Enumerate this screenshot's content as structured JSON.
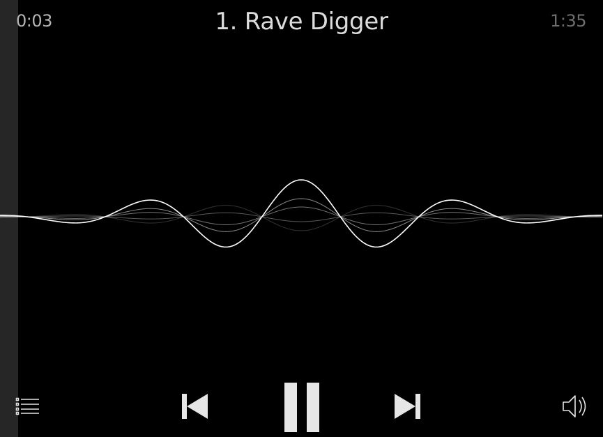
{
  "player": {
    "elapsed": "0:03",
    "title": "1. Rave Digger",
    "duration": "1:35"
  },
  "controls": {
    "playlist": "list-icon",
    "previous": "skip-previous-icon",
    "pause": "pause-icon",
    "next": "skip-next-icon",
    "volume": "speaker-icon"
  },
  "colors": {
    "background": "#000000",
    "side_strip": "#262626",
    "waveform": "#ffffff",
    "controls": "#e6e6e6"
  }
}
